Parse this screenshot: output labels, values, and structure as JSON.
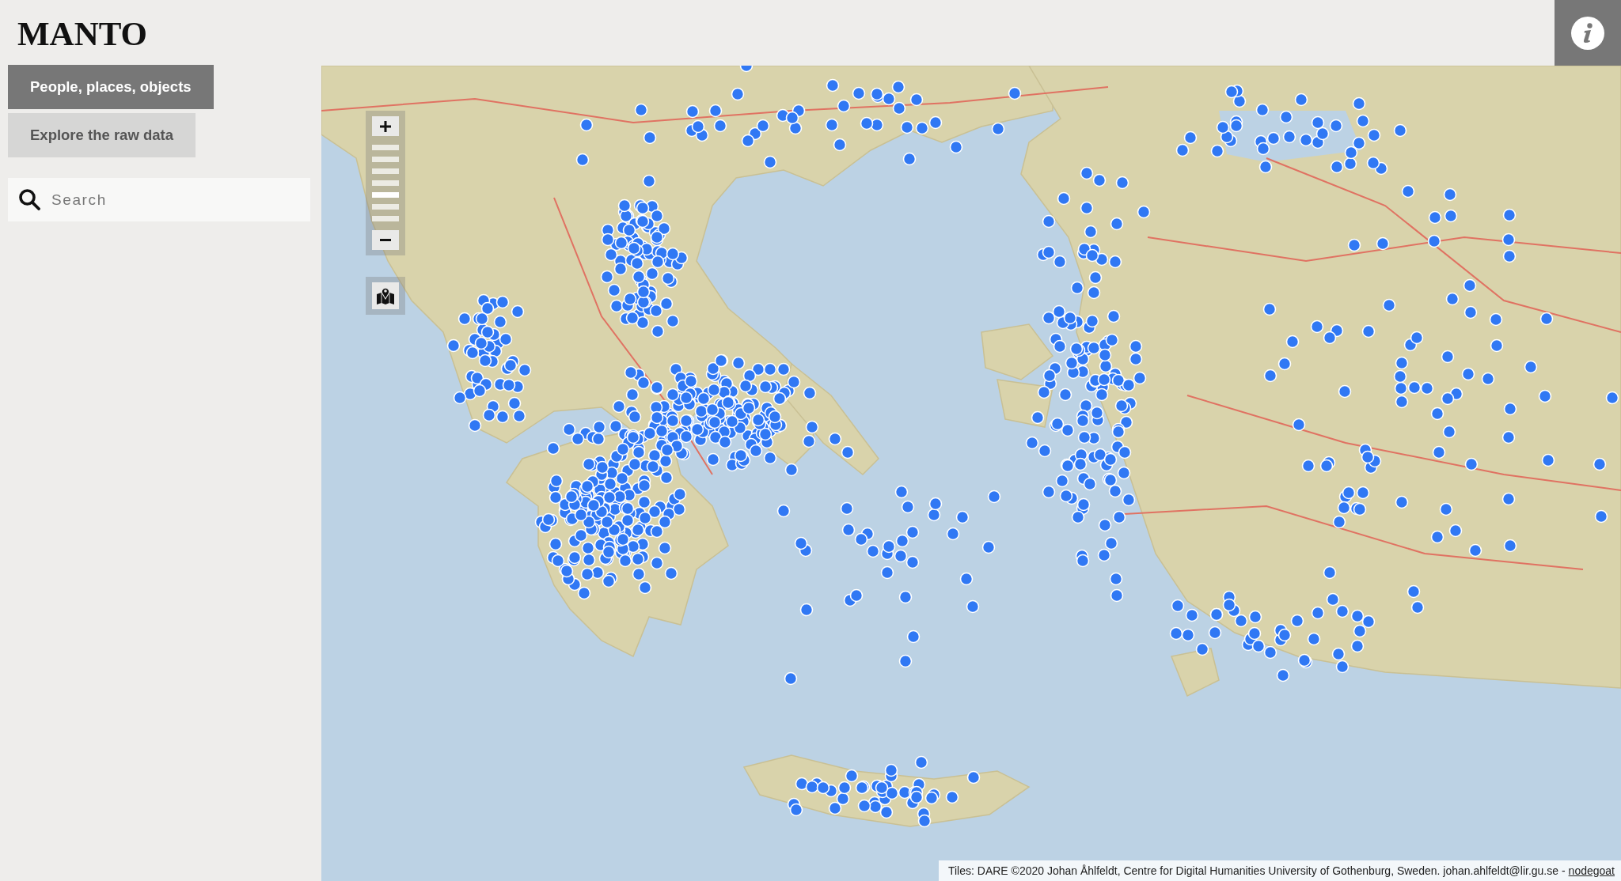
{
  "header": {
    "logo": "MANTO"
  },
  "sidebar": {
    "tabs": [
      {
        "label": "People, places, objects",
        "selected": true
      },
      {
        "label": "Explore the raw data",
        "selected": false
      }
    ],
    "search": {
      "placeholder": "Search"
    }
  },
  "map": {
    "zoom_slider": {
      "level": 0.333
    },
    "attribution": {
      "text": "Tiles: DARE ©2020 Johan Åhlfeldt, Centre for Digital Humanities University of Gothenburg, Sweden. johan.ahlfeldt@lir.gu.se -",
      "link": "nodegoat"
    }
  }
}
